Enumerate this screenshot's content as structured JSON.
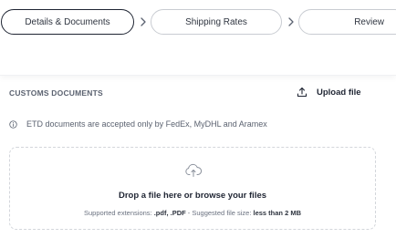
{
  "stepper": {
    "steps": [
      {
        "label": "Details & Documents",
        "active": true
      },
      {
        "label": "Shipping Rates",
        "active": false
      },
      {
        "label": "Review",
        "active": false
      }
    ]
  },
  "customs": {
    "title": "CUSTOMS DOCUMENTS",
    "upload_label": "Upload file",
    "notice": "ETD documents are accepted only by FedEx, MyDHL and Aramex"
  },
  "dropzone": {
    "title": "Drop a file here or browse your files",
    "hint_prefix": "Supported extensions: ",
    "extensions": ".pdf, .PDF",
    "hint_middle": " - Suggested file size: ",
    "size_limit": "less than 2 MB"
  },
  "icons": {
    "chevron": "chevron-right-icon",
    "upload": "upload-icon",
    "info": "info-icon",
    "cloud": "cloud-upload-icon"
  },
  "colors": {
    "text_primary": "#1f2533",
    "text_secondary": "#5b6270",
    "border": "#c9ccd2",
    "dropzone_border": "#d3d6db"
  }
}
